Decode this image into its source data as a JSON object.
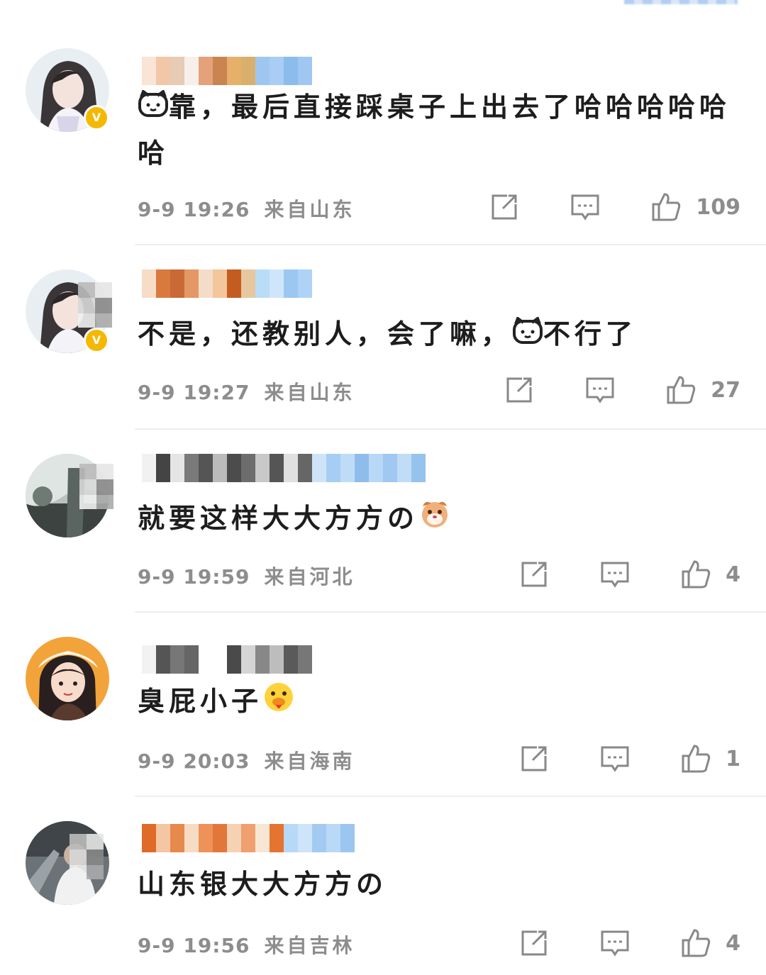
{
  "comments": [
    {
      "text": "靠，最后直接踩桌子上出去了哈哈哈哈哈哈",
      "prefix_emoji": "cat-face-emoji",
      "time": "9-9 19:26",
      "location": "来自山东",
      "likes": "109",
      "verified": true
    },
    {
      "text": "不是，还教别人，会了嘛，",
      "suffix_text": "不行了",
      "inline_emoji": "cat-face-emoji",
      "time": "9-9 19:27",
      "location": "来自山东",
      "likes": "27",
      "verified": true
    },
    {
      "text": "就要这样大大方方の",
      "suffix_emoji": "dog-face-emoji",
      "time": "9-9 19:59",
      "location": "来自河北",
      "likes": "4",
      "verified": false
    },
    {
      "text": "臭屁小子",
      "suffix_emoji": "duck-face-emoji",
      "time": "9-9 20:03",
      "location": "来自海南",
      "likes": "1",
      "verified": false
    },
    {
      "text": "山东银大大方方の",
      "time": "9-9 19:56",
      "location": "来自吉林",
      "likes": "4",
      "verified": false
    }
  ],
  "icons": {
    "share": "share-icon",
    "reply": "comment-icon",
    "like": "thumbs-up-icon"
  },
  "colors": {
    "verified_badge": "#f5b800",
    "meta_text": "#8d8d8d",
    "divider": "#eeeeee"
  }
}
